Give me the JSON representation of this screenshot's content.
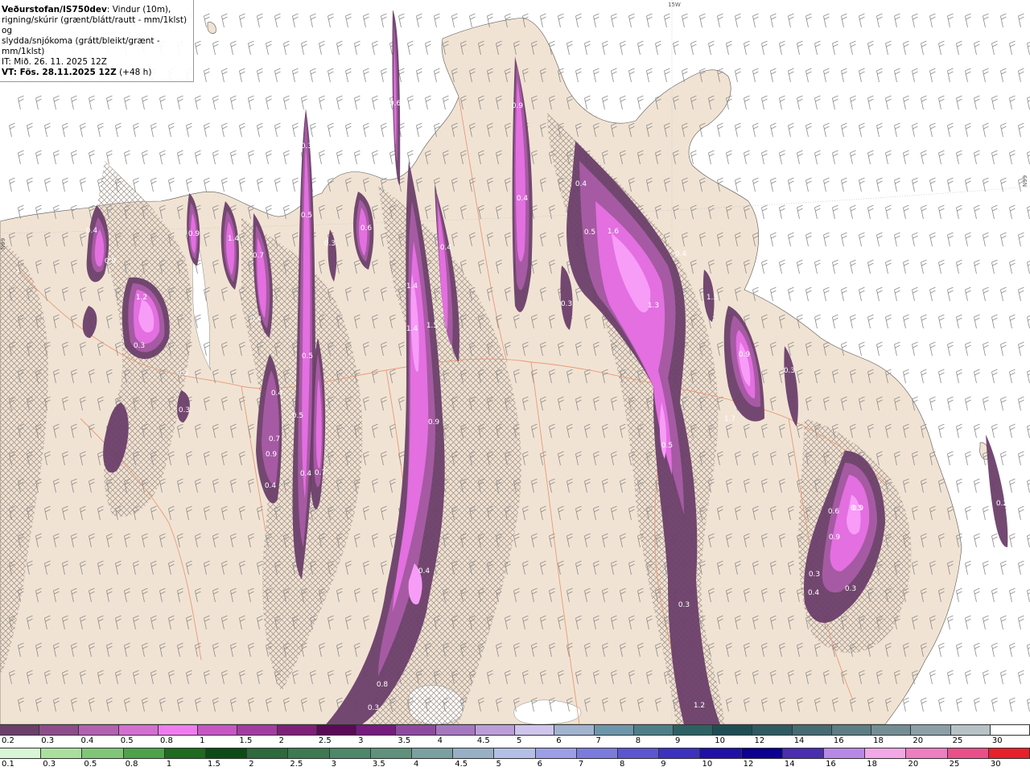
{
  "header": {
    "line1_bold": "Veðurstofan/IS750dev",
    "line1_rest": ": Vindur (10m),",
    "line2": "rigning/skúrir (grænt/blátt/rautt - mm/1klst) og",
    "line3": "slydda/snjókoma (grátt/bleikt/grænt - mm/1klst)",
    "init_time": "IT: Mið. 26. 11. 2025 12Z",
    "valid_time_bold": "VT: Fös. 28.11.2025 12Z",
    "valid_time_rest": " (+48 h)"
  },
  "map": {
    "colors": {
      "sea": "#ffffff",
      "land": "#f1e3d3",
      "roads": "#e89a7a",
      "hatch": "#9b8d84",
      "precip_light": "#6b3f6a",
      "precip_mid": "#a65aa3",
      "precip_heavy": "#e36fe0",
      "precip_peak": "#f79cf7",
      "wind_barb": "#8c8c8c"
    },
    "grid_labels": [
      "15W",
      "N99",
      "N99"
    ],
    "contour_labels": [
      "0.6",
      "0.9",
      "0.3",
      "0.4",
      "0.9",
      "1.4",
      "0.9",
      "1",
      "0.3",
      "1.2",
      "0.5",
      "0.7",
      "0.3",
      "0.3",
      "0.3",
      "0.6",
      "0.4",
      "1.6",
      "0.5",
      "1.3",
      "1.4",
      "1.4",
      "1.5",
      "0.9",
      "0.4",
      "0.5",
      "0.3",
      "0.4",
      "1.3",
      "0.9",
      "0.3",
      "1.7",
      "0.5",
      "0.3",
      "0.8",
      "0.4",
      "0.3",
      "1.2",
      "0.3",
      "0.3",
      "0.4",
      "0.9",
      "0.7",
      "0.4",
      "0.4",
      "0.7",
      "0.5",
      "0.4",
      "0.6",
      "0.9",
      "0.9",
      "0.4",
      "0.3",
      "0.4",
      "0.2"
    ]
  },
  "legend_snow": {
    "labels": [
      "0.2",
      "0.3",
      "0.4",
      "0.5",
      "0.8",
      "1",
      "1.5",
      "2",
      "2.5",
      "3",
      "3.5",
      "4",
      "4.5",
      "5",
      "6",
      "7",
      "8",
      "9",
      "10",
      "12",
      "14",
      "16",
      "18",
      "20",
      "25",
      "30"
    ],
    "colors": [
      "#6b3f6a",
      "#8d4d8b",
      "#b261b0",
      "#d36fd1",
      "#ef7cef",
      "#c656c4",
      "#a33ca1",
      "#7e2079",
      "#5a0a57",
      "#761b80",
      "#8f49a1",
      "#a677c1",
      "#bb9ed8",
      "#cfc4ec",
      "#a1b3cf",
      "#6e96aa",
      "#4e7f88",
      "#2d6163",
      "#1e4e54",
      "#2f5a62",
      "#466b72",
      "#5d7c83",
      "#748d94",
      "#8c9fa6",
      "#b7c2c6",
      "#ffffff"
    ]
  },
  "legend_rain": {
    "labels": [
      "0.1",
      "0.3",
      "0.5",
      "0.8",
      "1",
      "1.5",
      "2",
      "2.5",
      "3",
      "3.5",
      "4",
      "4.5",
      "5",
      "6",
      "7",
      "8",
      "9",
      "10",
      "12",
      "14",
      "16",
      "18",
      "20",
      "25",
      "30"
    ],
    "colors": [
      "#d9f7d7",
      "#aae09e",
      "#7fc777",
      "#4da34a",
      "#1f6b1f",
      "#0d4b16",
      "#2d6a3c",
      "#3d7a52",
      "#4e8769",
      "#5f917d",
      "#7aa0a2",
      "#97b0c6",
      "#b3bfe6",
      "#9c9fe8",
      "#7b7bdd",
      "#5b56cf",
      "#3c32bf",
      "#2010a8",
      "#0b0090",
      "#4b2db0",
      "#b888e6",
      "#f2a7e6",
      "#ee7ec2",
      "#ea4f8a",
      "#e8202b"
    ]
  }
}
